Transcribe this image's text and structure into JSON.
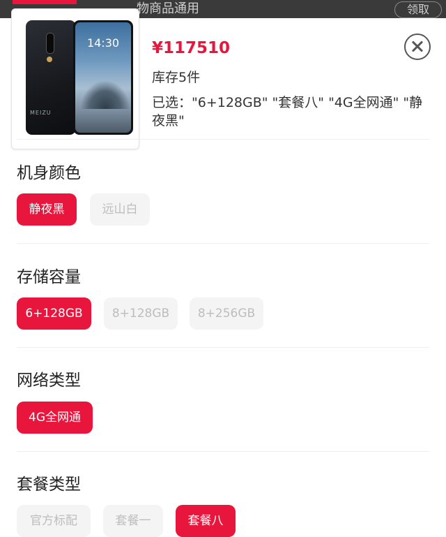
{
  "background_bar": {
    "text": "物商品通用",
    "button": "领取"
  },
  "product": {
    "image_brand": "MEIZU",
    "image_clock": "14:30",
    "price": "¥117510",
    "stock": "库存5件",
    "selected": "已选：\"6+128GB\" \"套餐八\" \"4G全网通\" \"静夜黑\""
  },
  "sections": {
    "color": {
      "title": "机身颜色",
      "options": [
        "静夜黑",
        "远山白"
      ]
    },
    "storage": {
      "title": "存储容量",
      "options": [
        "6+128GB",
        "8+128GB",
        "8+256GB"
      ]
    },
    "network": {
      "title": "网络类型",
      "options": [
        "4G全网通"
      ]
    },
    "package": {
      "title": "套餐类型",
      "options": [
        "官方标配",
        "套餐一",
        "套餐八"
      ]
    }
  },
  "colors": {
    "accent": "#e8163c",
    "inactive_bg": "#f4f4f4",
    "inactive_text": "#bdbdbd"
  }
}
